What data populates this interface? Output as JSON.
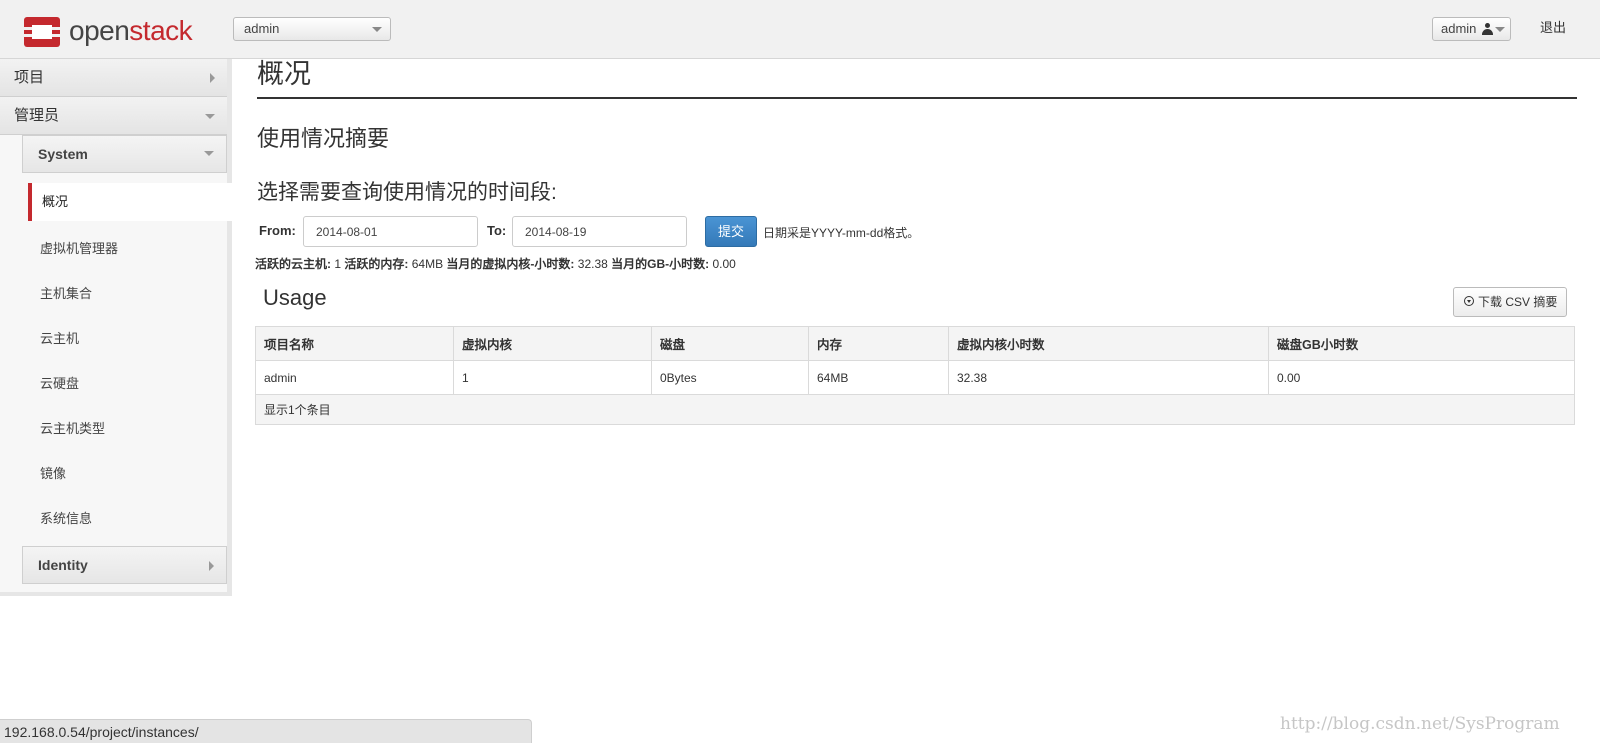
{
  "brand": {
    "name_part1": "open",
    "name_part2": "stack",
    "accent": "#c4292e"
  },
  "header": {
    "project_selector": "admin",
    "user_menu": "admin",
    "logout": "退出"
  },
  "sidebar": {
    "panels": [
      {
        "label": "项目"
      },
      {
        "label": "管理员"
      }
    ],
    "system_group": "System",
    "items": [
      {
        "label": "概况",
        "active": true
      },
      {
        "label": "虚拟机管理器"
      },
      {
        "label": "主机集合"
      },
      {
        "label": "云主机"
      },
      {
        "label": "云硬盘"
      },
      {
        "label": "云主机类型"
      },
      {
        "label": "镜像"
      },
      {
        "label": "系统信息"
      }
    ],
    "identity_group": "Identity"
  },
  "main": {
    "title": "概况",
    "section_title": "使用情况摘要",
    "range_title": "选择需要查询使用情况的时间段:",
    "form": {
      "from_label": "From:",
      "from_value": "2014-08-01",
      "to_label": "To:",
      "to_value": "2014-08-19",
      "submit": "提交",
      "hint": "日期采是YYYY-mm-dd格式。"
    },
    "stats": {
      "active_instances_label": "活跃的云主机:",
      "active_instances": "1",
      "active_memory_label": "活跃的内存:",
      "active_memory": "64MB",
      "vcpu_hours_label": "当月的虚拟内核-小时数:",
      "vcpu_hours": "32.38",
      "gb_hours_label": "当月的GB-小时数:",
      "gb_hours": "0.00"
    },
    "usage": {
      "title": "Usage",
      "csv_button": "下载 CSV 摘要",
      "columns": [
        "项目名称",
        "虚拟内核",
        "磁盘",
        "内存",
        "虚拟内核小时数",
        "磁盘GB小时数"
      ],
      "rows": [
        [
          "admin",
          "1",
          "0Bytes",
          "64MB",
          "32.38",
          "0.00"
        ]
      ],
      "footer": "显示1个条目"
    }
  },
  "status_url": "192.168.0.54/project/instances/",
  "watermark": "http://blog.csdn.net/SysProgram"
}
